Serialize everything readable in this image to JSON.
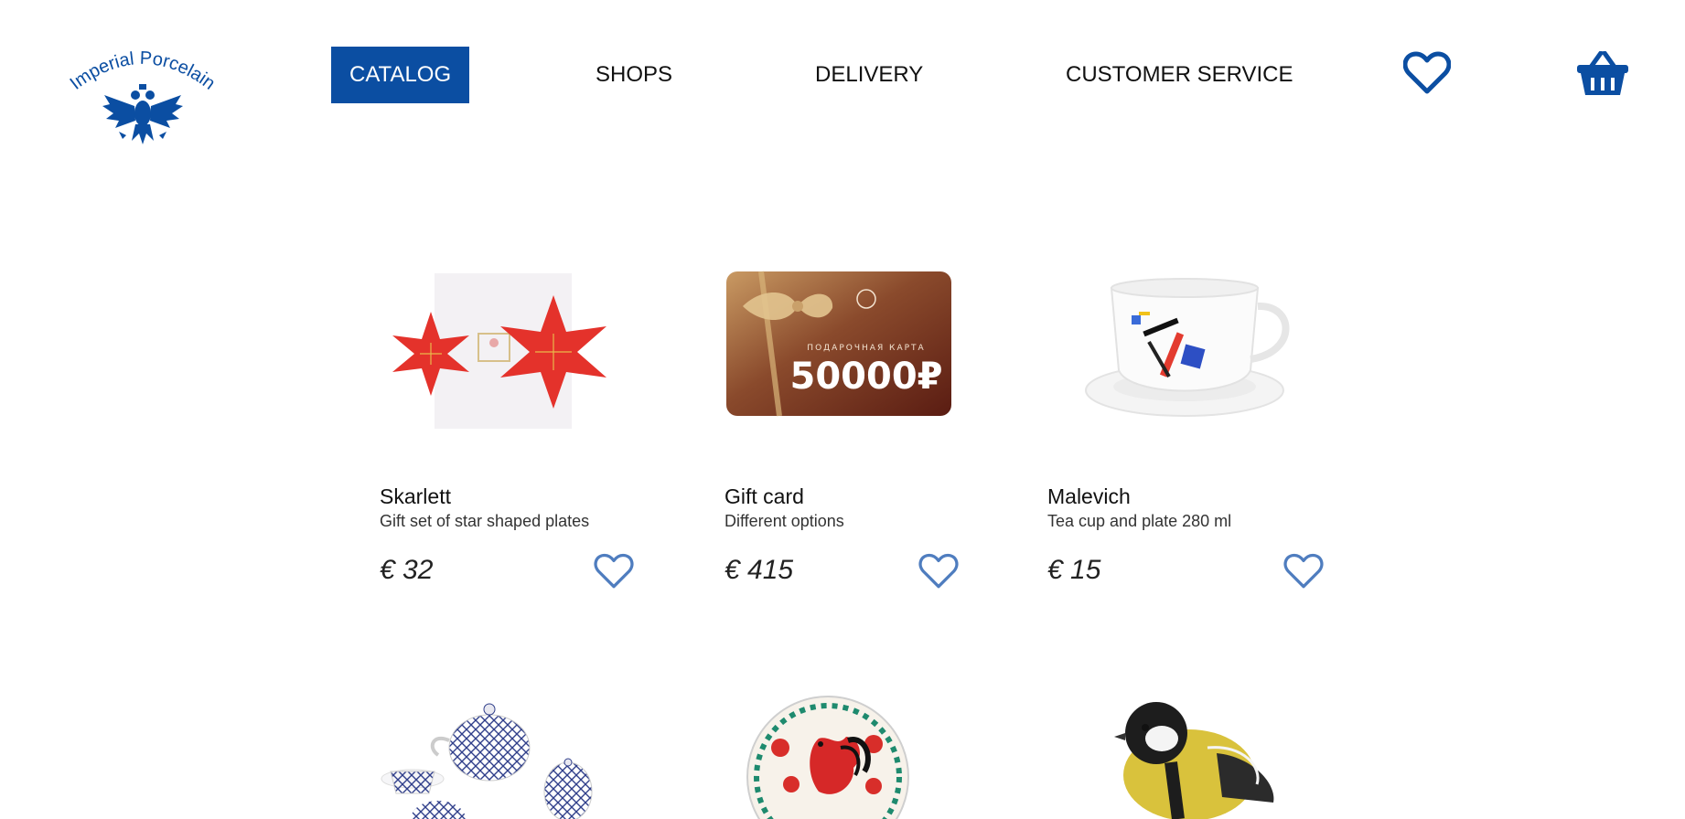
{
  "brand": {
    "logo_text": "Imperial Porcelain",
    "accent": "#0b4ea2",
    "heart_color": "#4f7dbf"
  },
  "nav": {
    "items": [
      {
        "label": "CATALOG",
        "active": true
      },
      {
        "label": "SHOPS",
        "active": false
      },
      {
        "label": "DELIVERY",
        "active": false
      },
      {
        "label": "CUSTOMER SERVICE",
        "active": false
      }
    ],
    "wishlist_icon": "heart-icon",
    "cart_icon": "basket-icon"
  },
  "products": [
    {
      "name": "Skarlett",
      "description": "Gift set of star shaped plates",
      "price": "€ 32",
      "image": "red-star-plates"
    },
    {
      "name": "Gift card",
      "description": "Different options",
      "price": "€ 415",
      "image": "gift-card",
      "card_title": "ПОДАРОЧНАЯ КАРТА",
      "card_amount": "50000₽"
    },
    {
      "name": "Malevich",
      "description": "Tea cup and plate 280 ml",
      "price": "€ 15",
      "image": "suprematist-tea-cup"
    }
  ],
  "products_row2": [
    {
      "image": "cobalt-net-tea-set"
    },
    {
      "image": "rooster-plate"
    },
    {
      "image": "titmouse-figurine"
    }
  ]
}
